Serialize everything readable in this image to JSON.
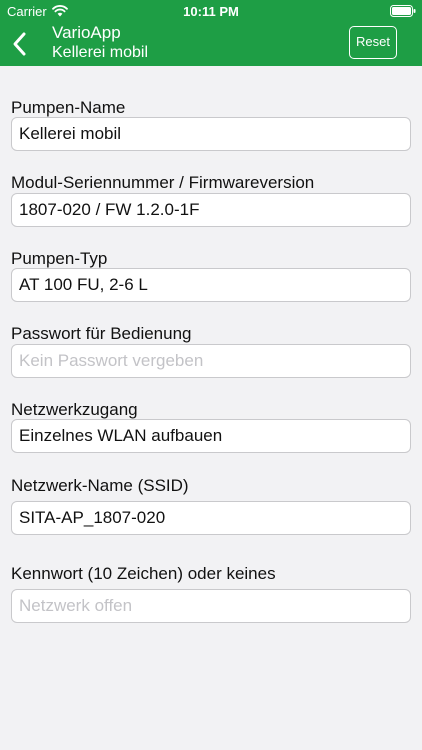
{
  "status_bar": {
    "carrier": "Carrier",
    "time": "10:11 PM",
    "wifi_icon": "wifi-icon",
    "battery_icon": "battery-icon"
  },
  "nav_bar": {
    "title": "VarioApp",
    "subtitle": "Kellerei mobil",
    "reset_label": "Reset",
    "back_icon": "chevron-left-icon",
    "color": "#1e9e45"
  },
  "form": {
    "pump_name": {
      "label": "Pumpen-Name",
      "value": "Kellerei mobil"
    },
    "module_serial": {
      "label": "Modul-Seriennummer / Firmwareversion",
      "value": "1807-020 / FW 1.2.0-1F"
    },
    "pump_type": {
      "label": "Pumpen-Typ",
      "value": "AT 100 FU, 2-6 L"
    },
    "password": {
      "label": "Passwort für Bedienung",
      "placeholder": "Kein Passwort vergeben"
    },
    "network_access": {
      "label": "Netzwerkzugang",
      "value": "Einzelnes WLAN aufbauen"
    },
    "network_name": {
      "label": "Netzwerk-Name (SSID)",
      "value": "SITA-AP_1807-020"
    },
    "network_key": {
      "label": "Kennwort (10 Zeichen) oder keines",
      "placeholder": "Netzwerk offen"
    }
  }
}
